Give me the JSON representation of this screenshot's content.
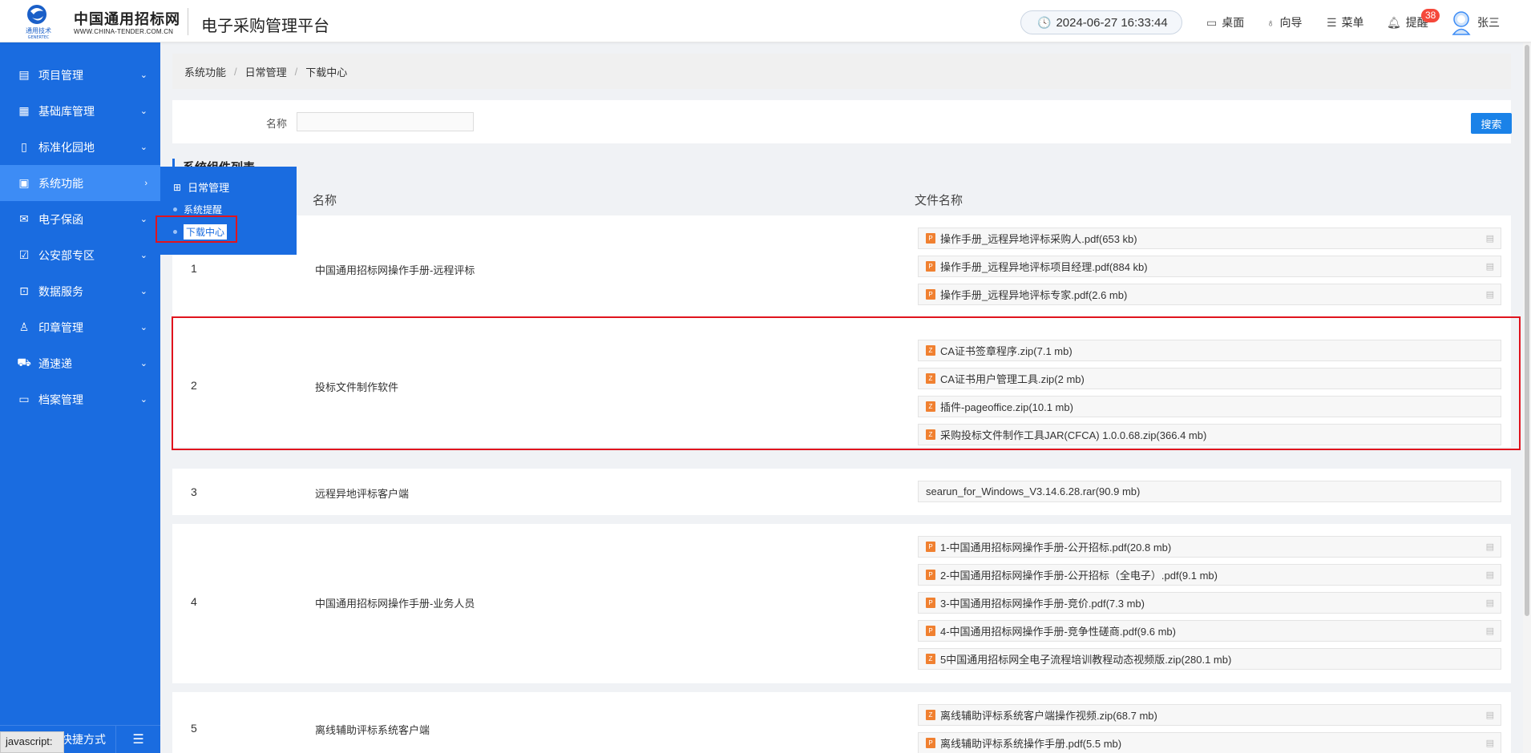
{
  "header": {
    "logo_text": "中国通用招标网",
    "logo_url": "WWW.CHINA-TENDER.COM.CN",
    "logo_brand": "通用技术",
    "logo_brand_en": "GENERTEC",
    "platform_title": "电子采购管理平台",
    "datetime": "2024-06-27 16:33:44",
    "nav": [
      {
        "label": "桌面",
        "icon": "desktop-icon"
      },
      {
        "label": "向导",
        "icon": "guide-icon"
      },
      {
        "label": "菜单",
        "icon": "menu-icon"
      },
      {
        "label": "提醒",
        "icon": "bell-icon"
      }
    ],
    "badge_count": "38",
    "username": "张三"
  },
  "sidebar": {
    "items": [
      {
        "label": "项目管理",
        "icon": "project-icon"
      },
      {
        "label": "基础库管理",
        "icon": "database-icon"
      },
      {
        "label": "标准化园地",
        "icon": "document-icon"
      },
      {
        "label": "系统功能",
        "icon": "monitor-icon"
      },
      {
        "label": "电子保函",
        "icon": "mail-icon"
      },
      {
        "label": "公安部专区",
        "icon": "police-icon"
      },
      {
        "label": "数据服务",
        "icon": "search-data-icon"
      },
      {
        "label": "印章管理",
        "icon": "stamp-icon"
      },
      {
        "label": "通速递",
        "icon": "truck-icon"
      },
      {
        "label": "档案管理",
        "icon": "archive-icon"
      }
    ],
    "active_index": 3,
    "shortcut_label": "快捷方式"
  },
  "flyout": {
    "group_label": "日常管理",
    "items": [
      "系统提醒",
      "下载中心"
    ]
  },
  "breadcrumb": [
    "系统功能",
    "日常管理",
    "下载中心"
  ],
  "search": {
    "label": "名称",
    "value": "",
    "button": "搜索"
  },
  "list_title": "系统组件列表",
  "table": {
    "headers": [
      "名称",
      "文件名称"
    ],
    "rows": [
      {
        "index": "1",
        "name": "中国通用招标网操作手册-远程评标",
        "files": [
          "操作手册_远程异地评标采购人.pdf(653 kb)",
          "操作手册_远程异地评标项目经理.pdf(884 kb)",
          "操作手册_远程异地评标专家.pdf(2.6 mb)"
        ]
      },
      {
        "index": "2",
        "name": "投标文件制作软件",
        "files": [
          "CA证书签章程序.zip(7.1 mb)",
          "CA证书用户管理工具.zip(2 mb)",
          "插件-pageoffice.zip(10.1 mb)",
          "采购投标文件制作工具JAR(CFCA) 1.0.0.68.zip(366.4 mb)"
        ]
      },
      {
        "index": "3",
        "name": "远程异地评标客户端",
        "files": [
          "searun_for_Windows_V3.14.6.28.rar(90.9 mb)"
        ]
      },
      {
        "index": "4",
        "name": "中国通用招标网操作手册-业务人员",
        "files": [
          "1-中国通用招标网操作手册-公开招标.pdf(20.8 mb)",
          "2-中国通用招标网操作手册-公开招标（全电子）.pdf(9.1 mb)",
          "3-中国通用招标网操作手册-竞价.pdf(7.3 mb)",
          "4-中国通用招标网操作手册-竞争性磋商.pdf(9.6 mb)",
          "5中国通用招标网全电子流程培训教程动态视频版.zip(280.1 mb)"
        ]
      },
      {
        "index": "5",
        "name": "离线辅助评标系统客户端",
        "files": [
          "离线辅助评标系统客户端操作视频.zip(68.7 mb)",
          "离线辅助评标系统操作手册.pdf(5.5 mb)"
        ]
      }
    ]
  },
  "status_tip": "javascript:"
}
